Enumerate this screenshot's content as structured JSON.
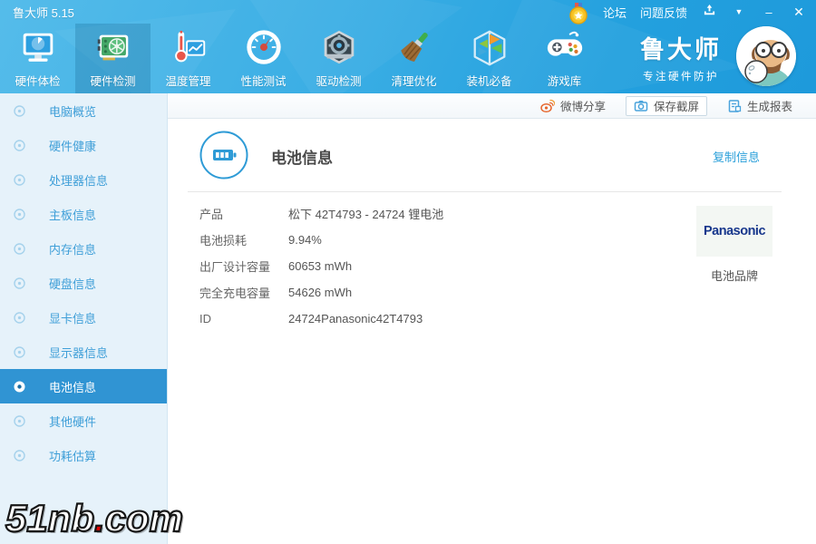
{
  "window": {
    "title": "鲁大师 5.15",
    "minimize": "–",
    "close": "✕",
    "caret": "▼"
  },
  "titlebar": {
    "forum": "论坛",
    "feedback": "问题反馈"
  },
  "header": {
    "tabs": [
      {
        "label": "硬件体检"
      },
      {
        "label": "硬件检测"
      },
      {
        "label": "温度管理"
      },
      {
        "label": "性能测试"
      },
      {
        "label": "驱动检测"
      },
      {
        "label": "清理优化"
      },
      {
        "label": "装机必备"
      },
      {
        "label": "游戏库"
      }
    ]
  },
  "brand": {
    "name": "鲁大师",
    "slogan": "专注硬件防护"
  },
  "toolbar": {
    "weibo": "微博分享",
    "screenshot": "保存截屏",
    "report": "生成报表"
  },
  "sidebar": {
    "items": [
      {
        "label": "电脑概览"
      },
      {
        "label": "硬件健康"
      },
      {
        "label": "处理器信息"
      },
      {
        "label": "主板信息"
      },
      {
        "label": "内存信息"
      },
      {
        "label": "硬盘信息"
      },
      {
        "label": "显卡信息"
      },
      {
        "label": "显示器信息"
      },
      {
        "label": "电池信息"
      },
      {
        "label": "其他硬件"
      },
      {
        "label": "功耗估算"
      }
    ],
    "active_index": 8
  },
  "main": {
    "title": "电池信息",
    "copy_link": "复制信息",
    "rows": [
      {
        "label": "产品",
        "value": "松下 42T4793 - 24724 锂电池"
      },
      {
        "label": "电池损耗",
        "value": "9.94%"
      },
      {
        "label": "出厂设计容量",
        "value": "60653 mWh"
      },
      {
        "label": "完全充电容量",
        "value": "54626 mWh"
      },
      {
        "label": "ID",
        "value": "24724Panasonic42T4793"
      }
    ],
    "brand_box": {
      "brand": "Panasonic",
      "caption": "电池品牌"
    }
  },
  "watermark": {
    "p1": "51nb",
    "dot": ".",
    "p2": "com"
  },
  "colors": {
    "accent_blue": "#2e9bd6",
    "header_top": "#55bcea",
    "header_bottom": "#1e9adb",
    "sidebar_bg": "#e6f2fa",
    "sidebar_active": "#3094d3",
    "weibo_orange": "#e6672e",
    "panasonic_navy": "#17378c",
    "watermark_red": "#e00000"
  }
}
